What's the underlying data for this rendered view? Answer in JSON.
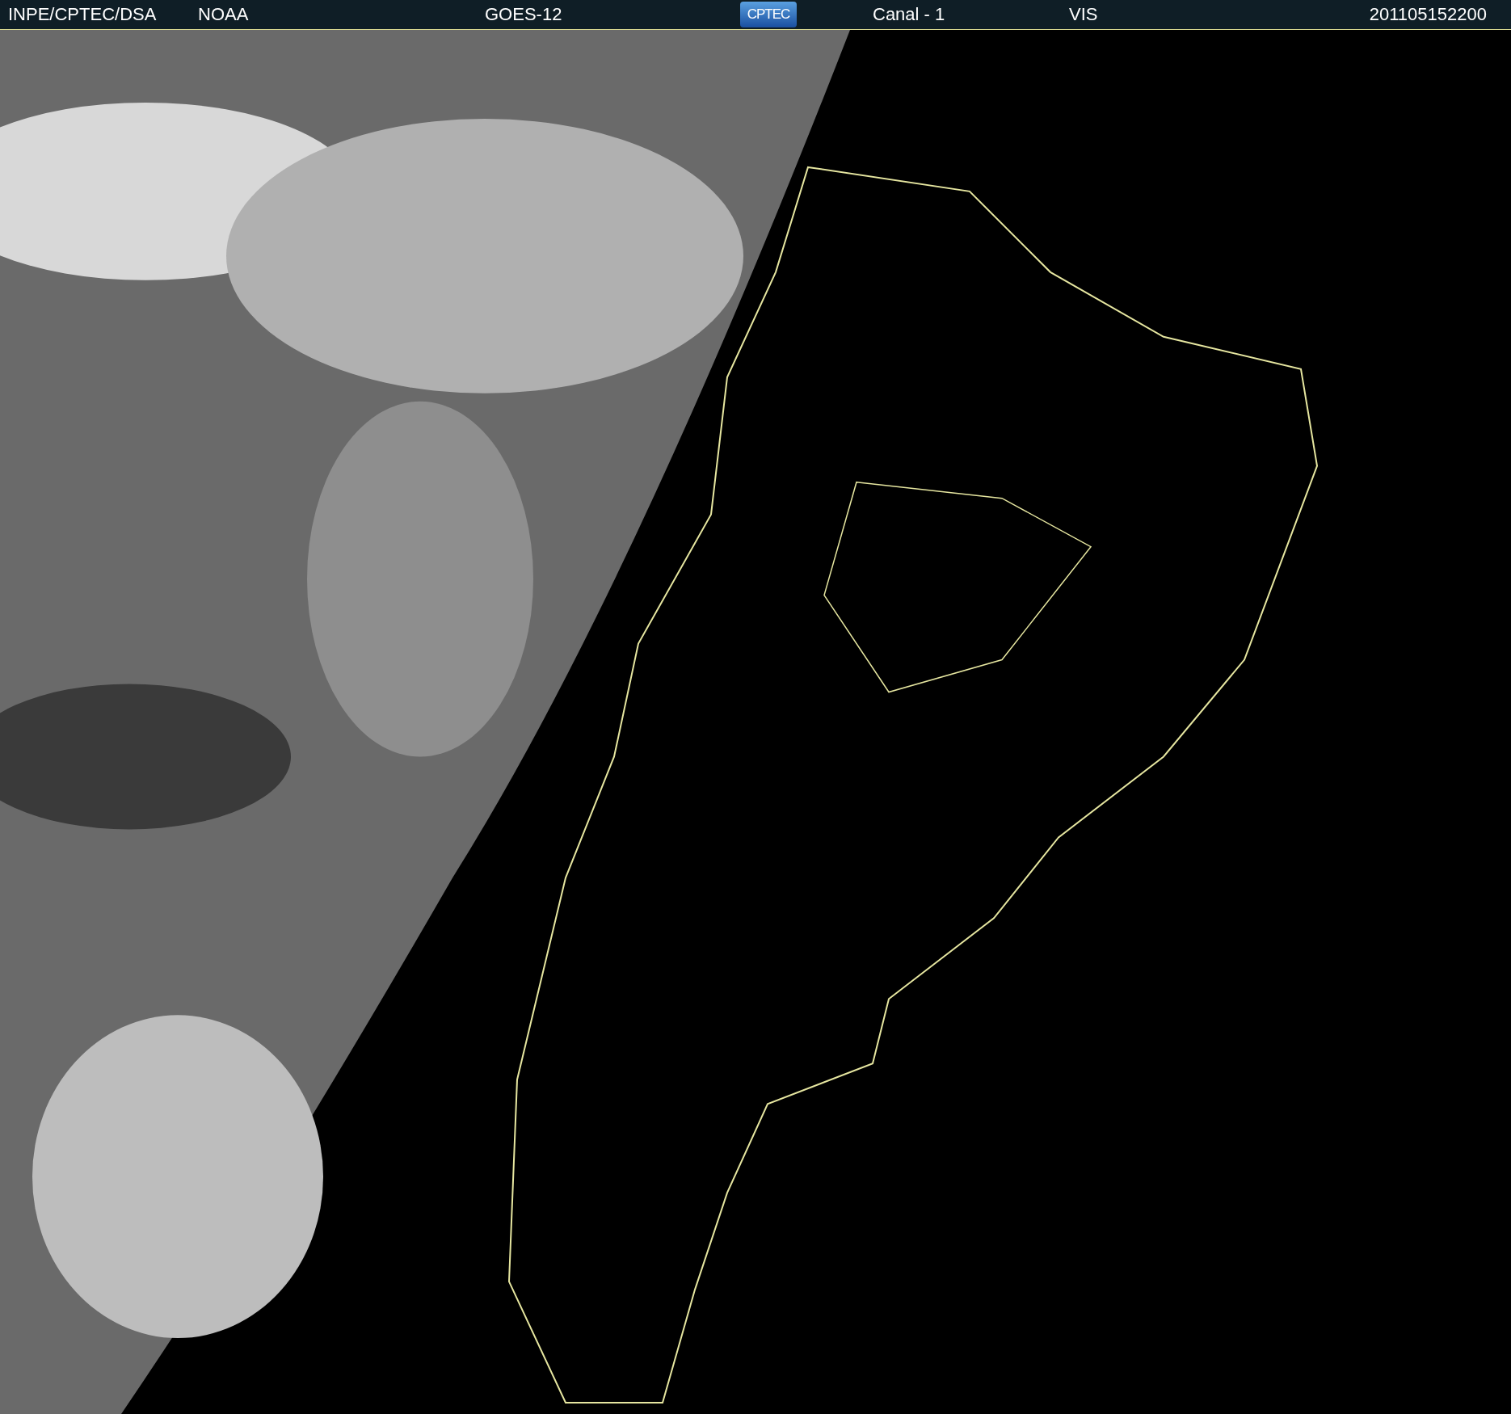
{
  "header": {
    "source": "INPE/CPTEC/DSA",
    "agency": "NOAA",
    "satellite": "GOES-12",
    "logo": "CPTEC",
    "channel": "Canal - 1",
    "band": "VIS",
    "timestamp": "201105152200"
  }
}
